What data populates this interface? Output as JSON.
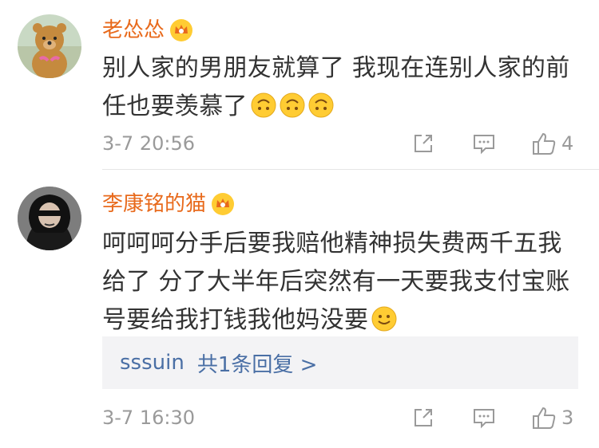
{
  "comments": [
    {
      "username": "老怂怂",
      "text_lines": [
        "别人家的男朋友就算了 我现在连别人家的前",
        "任也要羡慕了"
      ],
      "emojis": [
        "upside-down-face-icon",
        "upside-down-face-icon",
        "upside-down-face-icon"
      ],
      "timestamp": "3-7 20:56",
      "like_count": "4"
    },
    {
      "username": "李康铭的猫",
      "text_lines": [
        "呵呵呵分手后要我赔他精神损失费两千五我",
        "给了 分了大半年后突然有一天要我支付宝账",
        "号要给我打钱我他妈没要"
      ],
      "emojis": [
        "smile-face-icon"
      ],
      "reply": {
        "user": "sssuin",
        "summary": "共1条回复 >"
      },
      "timestamp": "3-7 16:30",
      "like_count": "3"
    }
  ],
  "colors": {
    "username": "#e86a1c",
    "reply_link": "#4a6fa5",
    "meta": "#9a9a9a",
    "text": "#333333"
  }
}
